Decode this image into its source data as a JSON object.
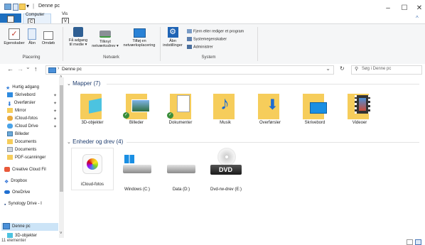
{
  "title_bar": {
    "separator": "|",
    "window_title": "Denne pc",
    "minimize": "–",
    "maximize": "☐",
    "close": "✕",
    "help": "^"
  },
  "ribbon_tabs": {
    "file": "F",
    "computer": "Computer",
    "computer_key": "C",
    "view": "Vis",
    "view_key": "V"
  },
  "ribbon": {
    "groups": {
      "placering": "Placering",
      "netvaerk": "Netværk",
      "system": "System"
    },
    "buttons": {
      "egenskaber": "Egenskaber",
      "aabn": "Åbn",
      "omdoeb": "Omdøb",
      "faa_adgang_1": "Få adgang",
      "faa_adgang_2": "til medie ▾",
      "tilknyt_1": "Tilknyt",
      "tilknyt_2": "netværksdrev ▾",
      "tilfoej_1": "Tilføj en",
      "tilfoej_2": "netværksplacering",
      "aabn_indst_1": "Åbn",
      "aabn_indst_2": "indstillinger",
      "fjern": "Fjern eller rediger et program",
      "systemegenskaber": "Systemegenskaber",
      "administrer": "Administrer"
    }
  },
  "address_bar": {
    "back": "←",
    "forward": "→",
    "dropdown": "⌄",
    "up": "↑",
    "crumb_sep": "›",
    "path": "Denne pc",
    "chevron": "⌄",
    "refresh": "↻",
    "search_icon": "⚲",
    "search_placeholder": "Søg i Denne pc"
  },
  "nav_pane": {
    "items": [
      {
        "label": "Hurtig adgang",
        "icon": "star-icon",
        "pinned": false
      },
      {
        "label": "Skrivebord",
        "icon": "desktop-icon",
        "pinned": true
      },
      {
        "label": "Overførsler",
        "icon": "download-icon",
        "pinned": true
      },
      {
        "label": "Mirror",
        "icon": "folder-icon",
        "pinned": true
      },
      {
        "label": "iCloud-fotos",
        "icon": "icloud-photos-icon",
        "pinned": true
      },
      {
        "label": "iCloud Drive",
        "icon": "icloud-drive-icon",
        "pinned": true
      },
      {
        "label": "Billeder",
        "icon": "pictures-icon",
        "pinned": false
      },
      {
        "label": "Documents",
        "icon": "folder-icon",
        "pinned": false
      },
      {
        "label": "Documents",
        "icon": "documents-icon",
        "pinned": false
      },
      {
        "label": "PDF-scanninger",
        "icon": "folder-icon",
        "pinned": false
      },
      {
        "label": "Creative Cloud Fil",
        "icon": "creative-cloud-icon",
        "pinned": false
      },
      {
        "label": "Dropbox",
        "icon": "dropbox-icon",
        "pinned": false
      },
      {
        "label": "OneDrive",
        "icon": "onedrive-icon",
        "pinned": false
      },
      {
        "label": "Synology Drive - I",
        "icon": "synology-icon",
        "pinned": false
      },
      {
        "label": "Denne pc",
        "icon": "pc-icon",
        "pinned": false
      },
      {
        "label": "3D-objekter",
        "icon": "3d-objects-icon",
        "pinned": false
      }
    ],
    "pin_glyph": "✦",
    "scroll_up": "˄",
    "scroll_down": "˅"
  },
  "content": {
    "folders_header": "Mapper (7)",
    "folders_toggle": "⌄",
    "folders": [
      "3D-objekter",
      "Billeder",
      "Dokumenter",
      "Musik",
      "Overførsler",
      "Skrivebord",
      "Videoer"
    ],
    "devices_header": "Enheder og drev (4)",
    "devices_toggle": "⌄",
    "devices": [
      "iCloud-fotos",
      "Windows (C:)",
      "Data (D:)",
      "Dvd-rw-drev (E:)"
    ],
    "dvd_label": "DVD"
  },
  "status_bar": {
    "count": "11 elementer"
  },
  "colors": {
    "accent": "#1e6fbf",
    "folder": "#f6cd5b",
    "selection": "#cce4f7"
  }
}
